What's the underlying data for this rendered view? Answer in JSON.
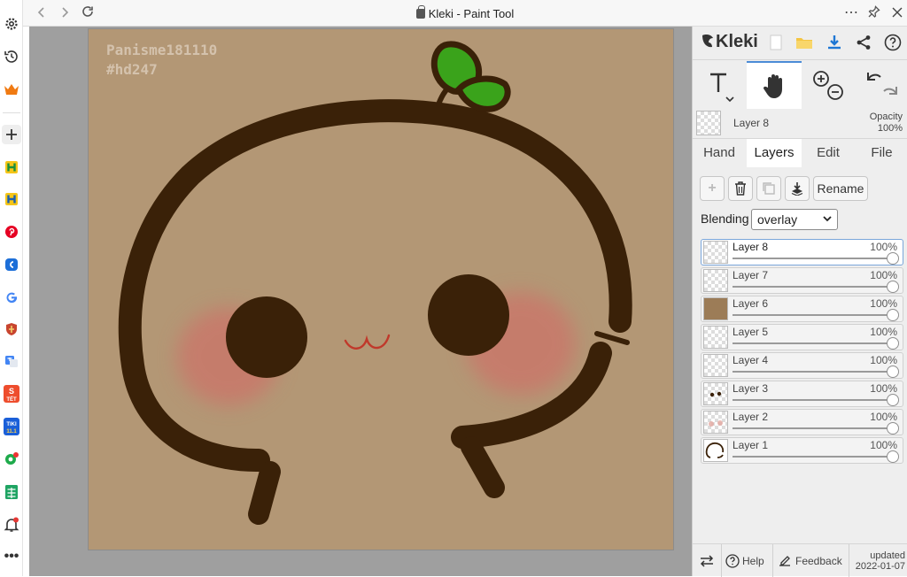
{
  "browser": {
    "title": "Kleki - Paint Tool",
    "menu_glyph": "⋯",
    "sidebar_icons": [
      "settings-icon",
      "history-icon",
      "crown-icon",
      "add-icon",
      "h-app-icon",
      "h-app-icon-2",
      "pinterest-icon",
      "blue-app-icon",
      "google-icon",
      "shield-app-icon",
      "translate-icon",
      "shopee-icon",
      "tiki-icon",
      "pin-app-icon",
      "sheets-icon",
      "notification-icon",
      "more-icon"
    ],
    "sidebar_labels": {
      "shopee": "TẾT",
      "tiki": "TIKI",
      "tiki_date": "11.1"
    }
  },
  "canvas": {
    "watermark_line1": "Panisme181110",
    "watermark_line2": "#hd247",
    "background_color": "#b39775"
  },
  "panel": {
    "logo": "Kleki",
    "current_layer": {
      "name": "Layer 8",
      "opacity_label": "Opacity",
      "opacity_value": "100%"
    },
    "tabs": [
      {
        "label": "Hand",
        "active": false
      },
      {
        "label": "Layers",
        "active": true
      },
      {
        "label": "Edit",
        "active": false
      },
      {
        "label": "File",
        "active": false
      }
    ],
    "actions": {
      "rename": "Rename"
    },
    "blending": {
      "label": "Blending",
      "value": "overlay"
    },
    "layers": [
      {
        "name": "Layer 8",
        "opacity": "100%",
        "selected": true
      },
      {
        "name": "Layer 7",
        "opacity": "100%",
        "selected": false
      },
      {
        "name": "Layer 6",
        "opacity": "100%",
        "selected": false
      },
      {
        "name": "Layer 5",
        "opacity": "100%",
        "selected": false
      },
      {
        "name": "Layer 4",
        "opacity": "100%",
        "selected": false
      },
      {
        "name": "Layer 3",
        "opacity": "100%",
        "selected": false
      },
      {
        "name": "Layer 2",
        "opacity": "100%",
        "selected": false
      },
      {
        "name": "Layer 1",
        "opacity": "100%",
        "selected": false
      }
    ],
    "footer": {
      "help": "Help",
      "feedback": "Feedback",
      "updated_label": "updated",
      "updated_date": "2022-01-07"
    }
  },
  "colors": {
    "accent": "#4b8bd6",
    "leaf": "#3aa31b",
    "outline": "#3a2108",
    "blush": "#c9786a",
    "canvas_bg": "#b39775"
  }
}
